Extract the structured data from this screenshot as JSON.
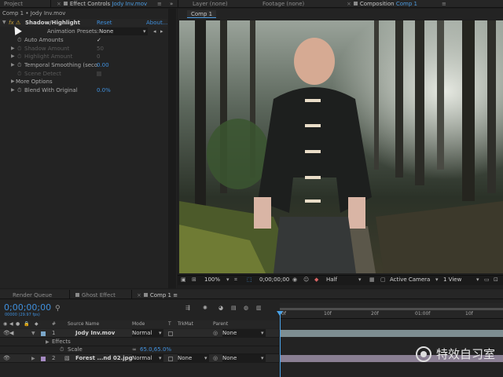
{
  "top_tabs": {
    "project": "Project",
    "effect_controls_prefix": "Effect Controls",
    "effect_controls_file": "Jody Inv.mov",
    "layer": "Layer (none)",
    "footage": "Footage (none)",
    "composition_prefix": "Composition",
    "composition_name": "Comp 1",
    "overflow": "»"
  },
  "effect_controls": {
    "breadcrumb": "Comp 1 • Jody Inv.mov",
    "fx_badge": "fx",
    "effect_name": "Shadow/Highlight",
    "reset": "Reset",
    "about": "About...",
    "presets_label": "Animation Presets:",
    "presets_value": "None",
    "properties": [
      {
        "label": "Auto Amounts",
        "value": "✓",
        "enabled": true
      },
      {
        "label": "Shadow Amount",
        "value": "50",
        "enabled": false
      },
      {
        "label": "Highlight Amount",
        "value": "0",
        "enabled": false
      },
      {
        "label": "Temporal Smoothing (seco",
        "value": "0.00",
        "enabled": true
      },
      {
        "label": "Scene Detect",
        "value": "",
        "enabled": false
      },
      {
        "label": "More Options",
        "value": "",
        "enabled": true
      },
      {
        "label": "Blend With Original",
        "value": "0.0%",
        "enabled": true
      }
    ]
  },
  "viewer": {
    "comp_tab": "Comp 1",
    "zoom": "100%",
    "timecode": "0;00;00;00",
    "resolution": "Half",
    "camera": "Active Camera",
    "views": "1 View"
  },
  "timeline": {
    "tabs": [
      "Render Queue",
      "Ghost Effect",
      "Comp 1"
    ],
    "timecode": "0;00;00;00",
    "fps": "00000 (29.97 fps)",
    "search_icon": "search-icon",
    "col_headers": {
      "num": "#",
      "source": "Source Name",
      "mode": "Mode",
      "t": "T",
      "trkmat": "TrkMat",
      "parent": "Parent"
    },
    "ruler_marks": [
      "0f",
      "10f",
      "20f",
      "01:00f",
      "10f"
    ],
    "layers": [
      {
        "num": "1",
        "name": "Jody Inv.mov",
        "mode": "Normal",
        "trkmat": "",
        "parent": "None"
      },
      {
        "num": "2",
        "name": "Forest ...nd 02.jpg",
        "mode": "Normal",
        "trkmat": "None",
        "parent": "None"
      }
    ],
    "effects_label": "Effects",
    "scale_label": "Scale",
    "scale_value": "65.0,65.0%"
  },
  "watermark": {
    "text": "特效自习室"
  },
  "colors": {
    "accent": "#3f8fdc",
    "playhead": "#4aa3e8",
    "track_bar": "#8d9a9e"
  }
}
